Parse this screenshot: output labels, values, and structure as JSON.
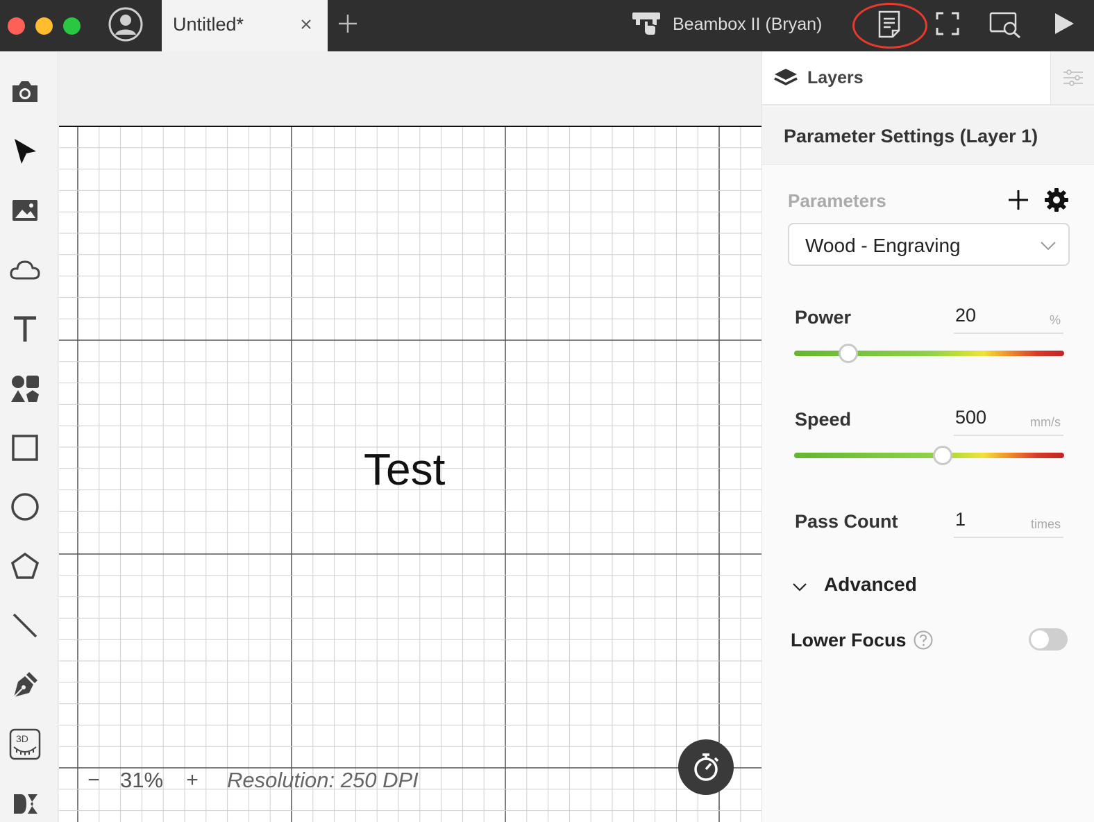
{
  "window": {
    "tab_title": "Untitled*",
    "device_name": "Beambox II (Bryan)"
  },
  "toolbar_icons": [
    "avatar-icon",
    "close-icon",
    "plus-icon",
    "device-icon",
    "task-list-icon",
    "frame-icon",
    "preview-icon",
    "play-icon"
  ],
  "left_tools": [
    "camera-icon",
    "cursor-icon",
    "image-icon",
    "cloud-icon",
    "text-icon",
    "shapes-icon",
    "rectangle-icon",
    "ellipse-icon",
    "polygon-icon",
    "line-icon",
    "pen-icon",
    "3d-curve-icon",
    "dmkt-icon"
  ],
  "canvas": {
    "text_object": "Test",
    "zoom_value": "31%",
    "zoom_minus": "−",
    "zoom_plus": "+",
    "resolution": "Resolution: 250 DPI"
  },
  "panel": {
    "layers_label": "Layers",
    "title": "Parameter Settings (Layer 1)",
    "parameters_label": "Parameters",
    "preset_value": "Wood - Engraving",
    "power": {
      "label": "Power",
      "value": "20",
      "unit": "%",
      "slider_fraction": 0.2
    },
    "speed": {
      "label": "Speed",
      "value": "500",
      "unit": "mm/s",
      "slider_fraction": 0.55
    },
    "pass_count": {
      "label": "Pass Count",
      "value": "1",
      "unit": "times"
    },
    "advanced_label": "Advanced",
    "lower_focus_label": "Lower Focus",
    "lower_focus_on": false
  },
  "colors": {
    "titlebar": "#2f2f2f",
    "highlight_ring": "#e8392f",
    "slider_green": "#64b52f",
    "slider_red": "#c22424"
  }
}
